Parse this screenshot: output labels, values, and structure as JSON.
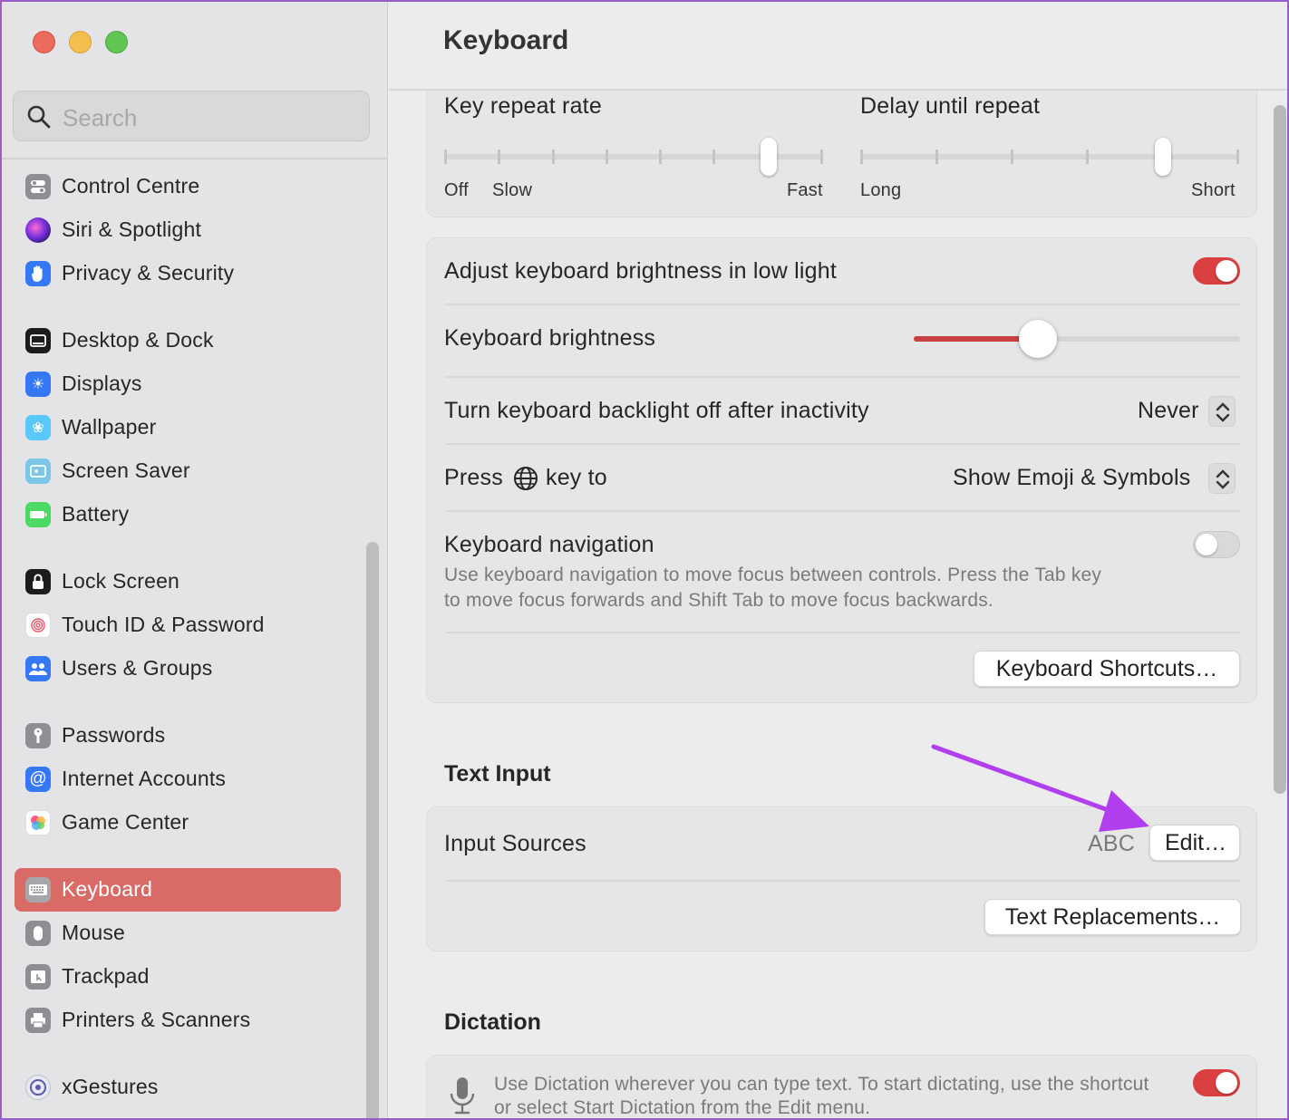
{
  "sidebar": {
    "search_placeholder": "Search",
    "items": [
      {
        "label": "Control Centre"
      },
      {
        "label": "Siri & Spotlight"
      },
      {
        "label": "Privacy & Security"
      },
      {
        "label": "Desktop & Dock"
      },
      {
        "label": "Displays"
      },
      {
        "label": "Wallpaper"
      },
      {
        "label": "Screen Saver"
      },
      {
        "label": "Battery"
      },
      {
        "label": "Lock Screen"
      },
      {
        "label": "Touch ID & Password"
      },
      {
        "label": "Users & Groups"
      },
      {
        "label": "Passwords"
      },
      {
        "label": "Internet Accounts"
      },
      {
        "label": "Game Center"
      },
      {
        "label": "Keyboard"
      },
      {
        "label": "Mouse"
      },
      {
        "label": "Trackpad"
      },
      {
        "label": "Printers & Scanners"
      },
      {
        "label": "xGestures"
      }
    ],
    "selected": "Keyboard"
  },
  "header": {
    "title": "Keyboard"
  },
  "repeat": {
    "key_repeat_label": "Key repeat rate",
    "key_repeat_left1": "Off",
    "key_repeat_left2": "Slow",
    "key_repeat_right": "Fast",
    "key_repeat_level": 6,
    "key_repeat_steps": 8,
    "delay_label": "Delay until repeat",
    "delay_left": "Long",
    "delay_right": "Short",
    "delay_level": 4,
    "delay_steps": 6
  },
  "brightness_card": {
    "adjust_label": "Adjust keyboard brightness in low light",
    "adjust_on": true,
    "brightness_label": "Keyboard brightness",
    "brightness_value": 0.38,
    "backlight_label": "Turn keyboard backlight off after inactivity",
    "backlight_value": "Never",
    "press_label_pre": "Press",
    "press_label_post": "key to",
    "press_value": "Show Emoji & Symbols",
    "nav_label": "Keyboard navigation",
    "nav_desc_line1": "Use keyboard navigation to move focus between controls. Press the Tab key",
    "nav_desc_line2": "to move focus forwards and Shift Tab to move focus backwards.",
    "nav_on": false,
    "shortcuts_button": "Keyboard Shortcuts…"
  },
  "text_input": {
    "section_title": "Text Input",
    "input_sources_label": "Input Sources",
    "input_sources_value": "ABC",
    "edit_button": "Edit…",
    "replacements_button": "Text Replacements…"
  },
  "dictation": {
    "section_title": "Dictation",
    "desc_line1": "Use Dictation wherever you can type text. To start dictating, use the shortcut",
    "desc_line2": "or select Start Dictation from the Edit menu.",
    "on": true
  },
  "colors": {
    "accent": "#d9403f",
    "selection": "#d96a66",
    "annotation_arrow": "#b13ff0"
  }
}
